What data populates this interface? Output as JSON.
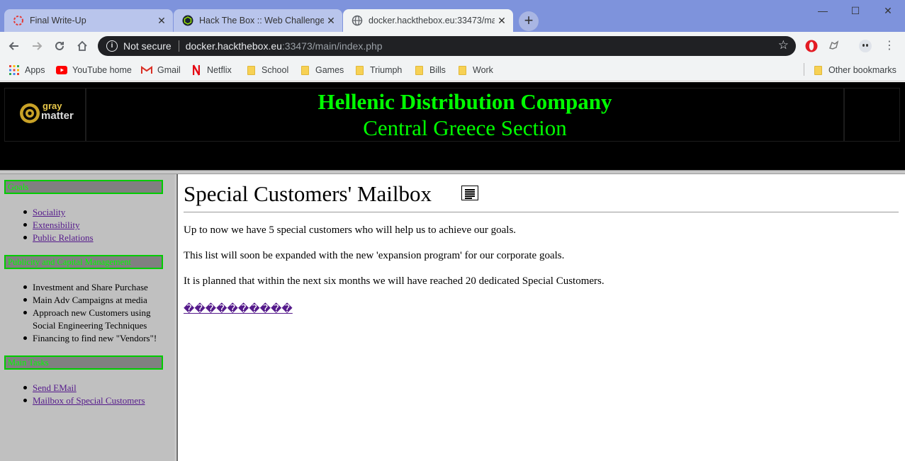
{
  "browser": {
    "tabs": [
      {
        "title": "Final Write-Up",
        "active": false
      },
      {
        "title": "Hack The Box :: Web Challenges",
        "active": false
      },
      {
        "title": "docker.hackthebox.eu:33473/mai",
        "active": true
      }
    ],
    "new_tab": "+",
    "window_controls": {
      "minimize": "—",
      "maximize": "☐",
      "close": "✕"
    },
    "security_label": "Not secure",
    "url_host": "docker.hackthebox.eu",
    "url_path": ":33473/main/index.php",
    "bookmarks": [
      {
        "label": "Apps",
        "icon": "apps-grid-icon"
      },
      {
        "label": "YouTube home",
        "icon": "youtube-icon"
      },
      {
        "label": "Gmail",
        "icon": "gmail-icon"
      },
      {
        "label": "Netflix",
        "icon": "netflix-icon"
      },
      {
        "label": "School",
        "icon": "folder-icon"
      },
      {
        "label": "Games",
        "icon": "folder-icon"
      },
      {
        "label": "Triumph",
        "icon": "folder-icon"
      },
      {
        "label": "Bills",
        "icon": "folder-icon"
      },
      {
        "label": "Work",
        "icon": "folder-icon"
      }
    ],
    "other_bookmarks": "Other bookmarks"
  },
  "header": {
    "title": "Hellenic Distribution Company",
    "subtitle": "Central Greece Section",
    "logo_text_top": "gray",
    "logo_text_bottom": "matter"
  },
  "sidebar": {
    "goals_heading": "Goals",
    "goals": [
      "Sociality",
      "Extensibility",
      "Public Relations"
    ],
    "publicity_heading": "Publicity and Capital Management",
    "publicity": [
      "Investment and Share Purchase",
      "Main Adv Campaigns at media",
      "Approach new Customers using Social Engineering Techniques",
      "Financing to find new \"Vendors\"!"
    ],
    "tasks_heading": "Main Tasks",
    "tasks": [
      "Send EMail",
      "Mailbox of Special Customers"
    ]
  },
  "main": {
    "title": "Special Customers' Mailbox",
    "paragraphs": [
      "Up to now we have 5 special customers who will help us to achieve our goals.",
      "This list will soon be expanded with the new 'expansion program' for our corporate goals.",
      "It is planned that within the next six months we will have reached 20 dedicated Special Customers."
    ],
    "link_text": "����������"
  },
  "colors": {
    "tabstrip": "#7e93dc",
    "header_bg": "#000000",
    "header_text": "#00ff00",
    "sidebar_bg": "#c0c0c0",
    "section_head_bg": "#808080",
    "link": "#551a8b"
  }
}
